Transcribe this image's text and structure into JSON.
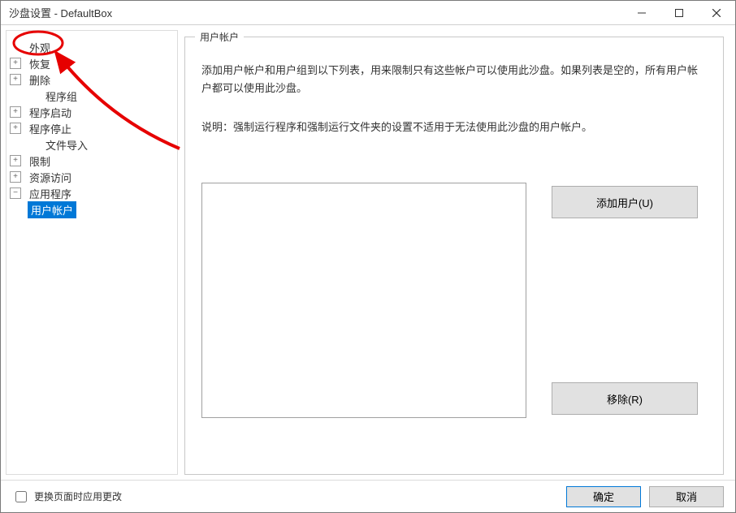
{
  "window": {
    "title": "沙盘设置 - DefaultBox"
  },
  "tree": {
    "items": [
      {
        "label": "外观",
        "expandable": false
      },
      {
        "label": "恢复",
        "expandable": true
      },
      {
        "label": "删除",
        "expandable": true
      },
      {
        "label": "程序组",
        "expandable": false,
        "indent": true
      },
      {
        "label": "程序启动",
        "expandable": true
      },
      {
        "label": "程序停止",
        "expandable": true
      },
      {
        "label": "文件导入",
        "expandable": false,
        "indent": true
      },
      {
        "label": "限制",
        "expandable": true
      },
      {
        "label": "资源访问",
        "expandable": true
      },
      {
        "label": "应用程序",
        "expandable": true,
        "expanded": true,
        "children": [
          {
            "label": "用户帐户",
            "selected": true
          }
        ]
      }
    ]
  },
  "panel": {
    "title": "用户帐户",
    "description": "添加用户帐户和用户组到以下列表，用来限制只有这些帐户可以使用此沙盘。如果列表是空的，所有用户帐户都可以使用此沙盘。",
    "note": "说明：强制运行程序和强制运行文件夹的设置不适用于无法使用此沙盘的用户帐户。",
    "add_label": "添加用户(U)",
    "remove_label": "移除(R)"
  },
  "footer": {
    "apply_on_change_label": "更换页面时应用更改",
    "ok_label": "确定",
    "cancel_label": "取消"
  },
  "annotation": {
    "ellipse_stroke": "#e60000",
    "arrow_stroke": "#e60000"
  }
}
